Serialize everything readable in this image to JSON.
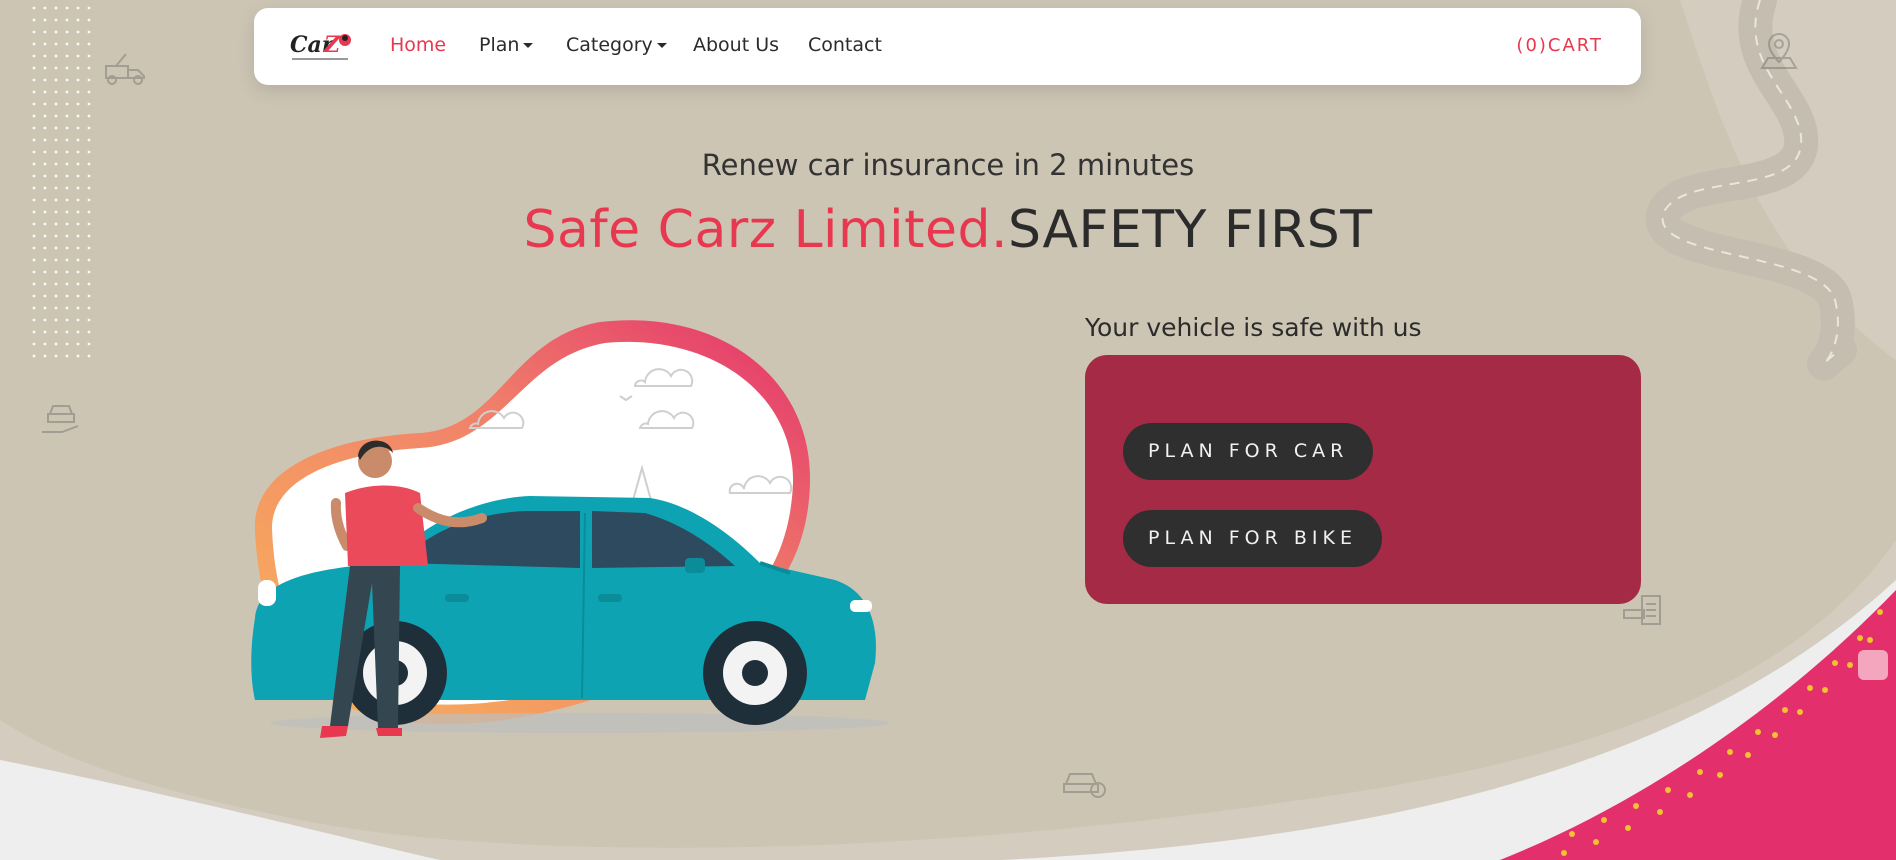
{
  "navbar": {
    "logo_alt": "Carz - Your Safety, Our Promise",
    "links": [
      {
        "label": "Home",
        "active": true
      },
      {
        "label": "Plan",
        "dropdown": true
      },
      {
        "label": "Category",
        "dropdown": true
      },
      {
        "label": "About Us"
      },
      {
        "label": "Contact"
      }
    ],
    "cart_label": "(0)CART"
  },
  "hero": {
    "subtitle": "Renew car insurance in 2 minutes",
    "headline_brand": "Safe Carz Limited.",
    "headline_rest": "SAFETY FIRST"
  },
  "plans": {
    "title": "Your vehicle is safe with us",
    "buttons": [
      "PLAN FOR CAR",
      "PLAN FOR BIKE"
    ]
  },
  "colors": {
    "accent": "#e8384f",
    "card": "#a42a45",
    "button": "#2f2f2f",
    "background": "#cdc5b4",
    "car": "#0ea3b3"
  },
  "icons": [
    "tow-truck-icon",
    "car-hand-icon",
    "location-pin-icon",
    "car-document-icon",
    "car-check-icon"
  ]
}
